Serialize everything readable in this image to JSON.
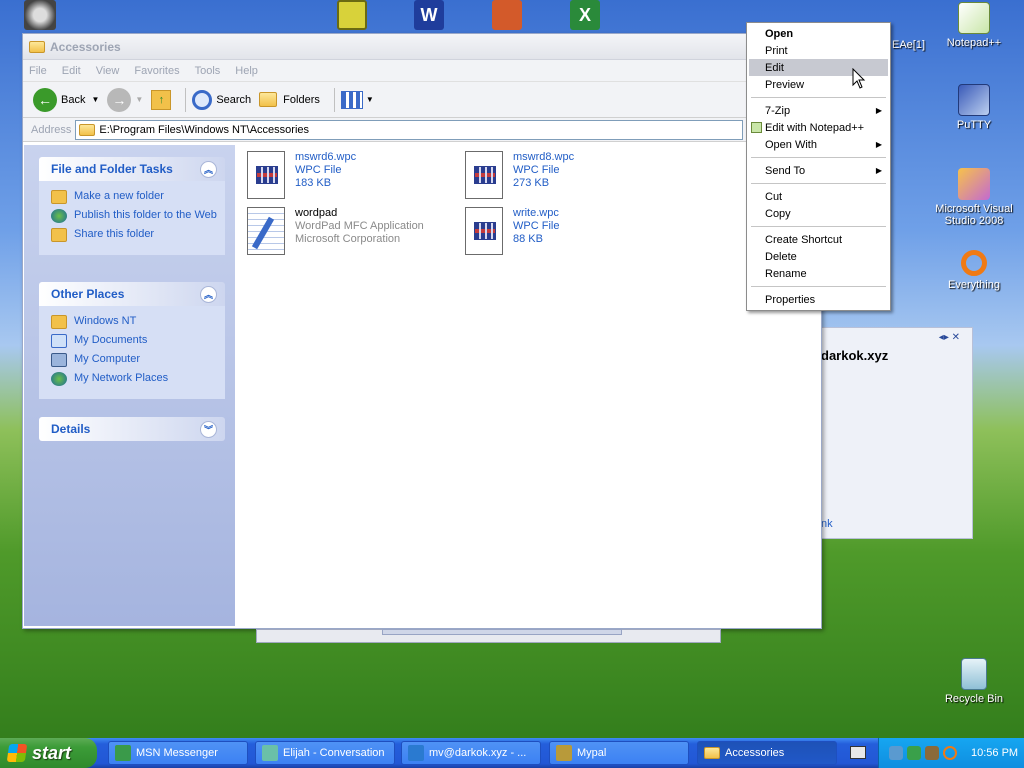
{
  "desktop": {
    "icons": [
      {
        "label": "Notepad++"
      },
      {
        "label": "PuTTY"
      },
      {
        "label": "Microsoft Visual Studio 2008"
      },
      {
        "label": "Everything"
      },
      {
        "label": "Recycle Bin"
      }
    ],
    "partial_label": "EAe[1]"
  },
  "explorer": {
    "title": "Accessories",
    "menu": [
      "File",
      "Edit",
      "View",
      "Favorites",
      "Tools",
      "Help"
    ],
    "toolbar": {
      "back": "Back",
      "search": "Search",
      "folders": "Folders"
    },
    "address_label": "Address",
    "address_value": "E:\\Program Files\\Windows NT\\Accessories",
    "tasks_panel": {
      "title": "File and Folder Tasks",
      "items": [
        "Make a new folder",
        "Publish this folder to the Web",
        "Share this folder"
      ]
    },
    "places_panel": {
      "title": "Other Places",
      "items": [
        "Windows NT",
        "My Documents",
        "My Computer",
        "My Network Places"
      ]
    },
    "details_panel": {
      "title": "Details"
    },
    "files": [
      {
        "name": "mswrd6.wpc",
        "type": "WPC File",
        "size": "183 KB"
      },
      {
        "name": "mswrd8.wpc",
        "type": "WPC File",
        "size": "273 KB"
      },
      {
        "name": "wordpad",
        "type": "WordPad MFC Application",
        "size": "Microsoft Corporation"
      },
      {
        "name": "write.wpc",
        "type": "WPC File",
        "size": "88 KB"
      }
    ]
  },
  "context_menu": {
    "items": [
      "Open",
      "Print",
      "Edit",
      "Preview",
      "7-Zip",
      "Edit with Notepad++",
      "Open With",
      "Send To",
      "Cut",
      "Copy",
      "Create Shortcut",
      "Delete",
      "Rename",
      "Properties"
    ]
  },
  "behind_window": {
    "text": "darkok.xyz",
    "link": "nk"
  },
  "taskbar": {
    "start": "start",
    "tasks": [
      "MSN Messenger",
      "Elijah - Conversation",
      "mv@darkok.xyz - ...",
      "Mypal",
      "Accessories"
    ],
    "clock": "10:56 PM"
  },
  "colors": {
    "link": "#215dc6",
    "selection": "#c7c9d1",
    "taskbar": "#245edb",
    "start": "#3c9c38"
  }
}
